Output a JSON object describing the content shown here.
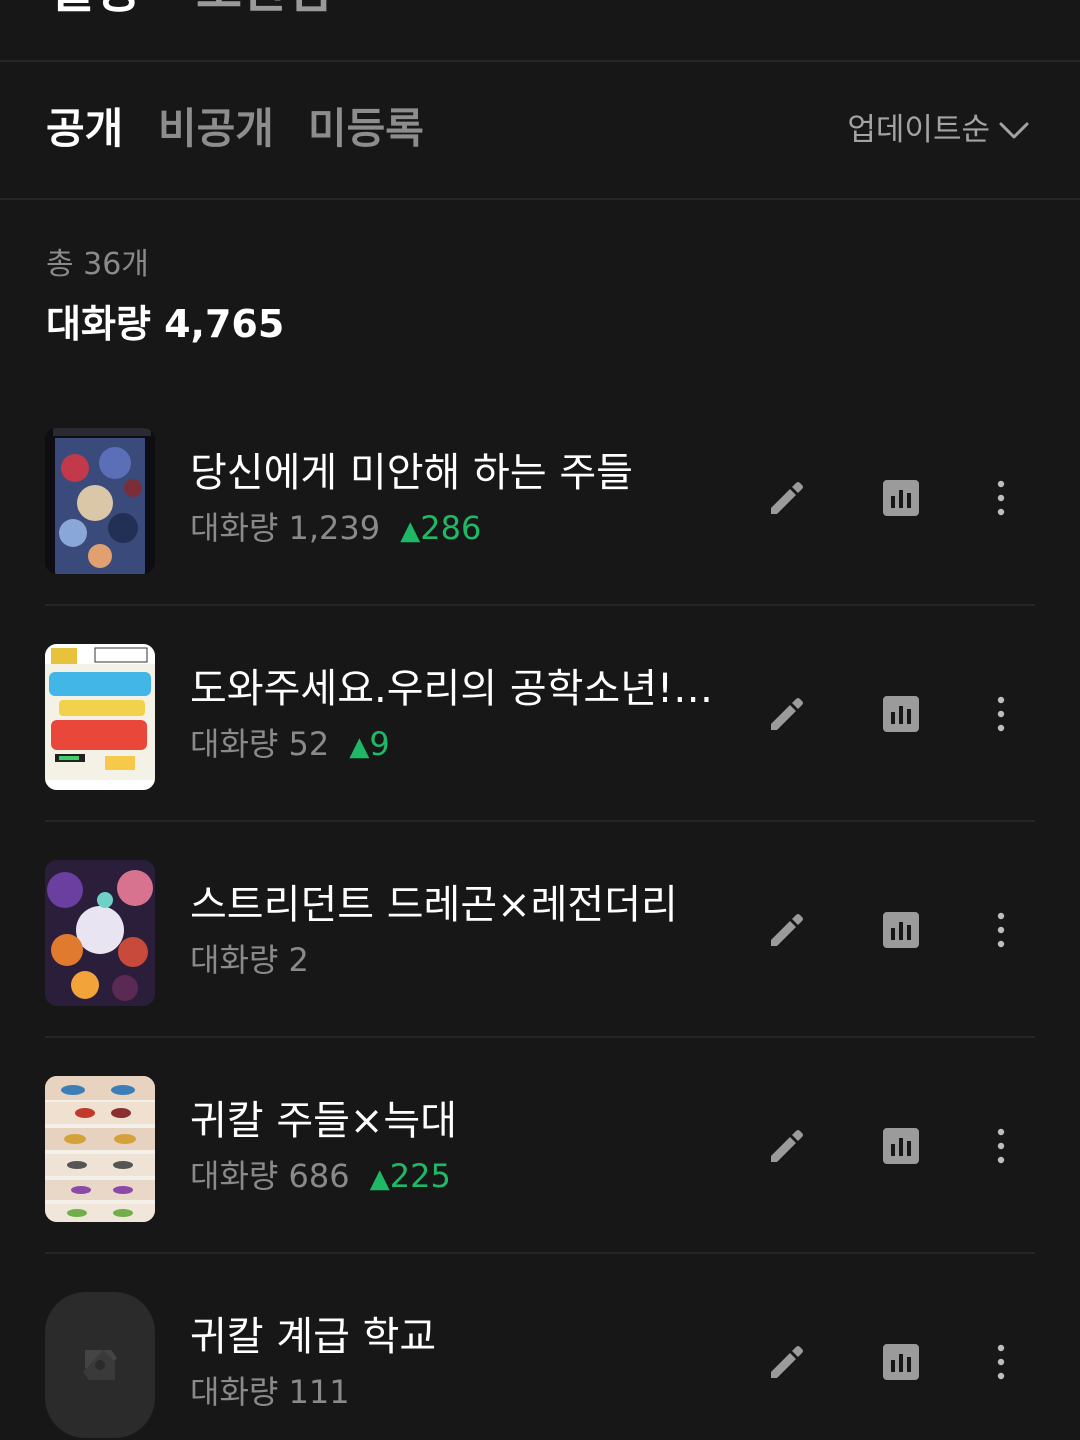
{
  "header": {
    "title": "설정",
    "subtitle": "보관함"
  },
  "tabs": [
    {
      "label": "공개",
      "active": true
    },
    {
      "label": "비공개",
      "active": false
    },
    {
      "label": "미등록",
      "active": false
    }
  ],
  "sort": {
    "label": "업데이트순"
  },
  "summary": {
    "count_text": "총 36개",
    "total_text": "대화량 4,765"
  },
  "stories": [
    {
      "title": "당신에게 미안해 하는 주들",
      "stat_label": "대화량",
      "stat_value": "1,239",
      "delta_arrow": "▲",
      "delta": "286",
      "thumb": "poster-characters"
    },
    {
      "title": "도와주세요.우리의 공학소년!(공학소년을...",
      "stat_label": "대화량",
      "stat_value": "52",
      "delta_arrow": "▲",
      "delta": "9",
      "thumb": "comic-title-art"
    },
    {
      "title": "스트리던트 드레곤×레전더리",
      "stat_label": "대화량",
      "stat_value": "2",
      "delta_arrow": "",
      "delta": "",
      "thumb": "colorful-characters"
    },
    {
      "title": "귀칼 주들×늑대",
      "stat_label": "대화량",
      "stat_value": "686",
      "delta_arrow": "▲",
      "delta": "225",
      "thumb": "eyes-collage"
    },
    {
      "title": "귀칼 계급 학교",
      "stat_label": "대화량",
      "stat_value": "111",
      "delta_arrow": "",
      "delta": "",
      "thumb": "placeholder-logo"
    }
  ],
  "colors": {
    "background": "#171717",
    "accent_green": "#1fb866",
    "muted_text": "#8a8a8a"
  },
  "icons": [
    "search-icon",
    "chevron-down-icon",
    "pencil-icon",
    "stats-icon",
    "more-vertical-icon"
  ]
}
